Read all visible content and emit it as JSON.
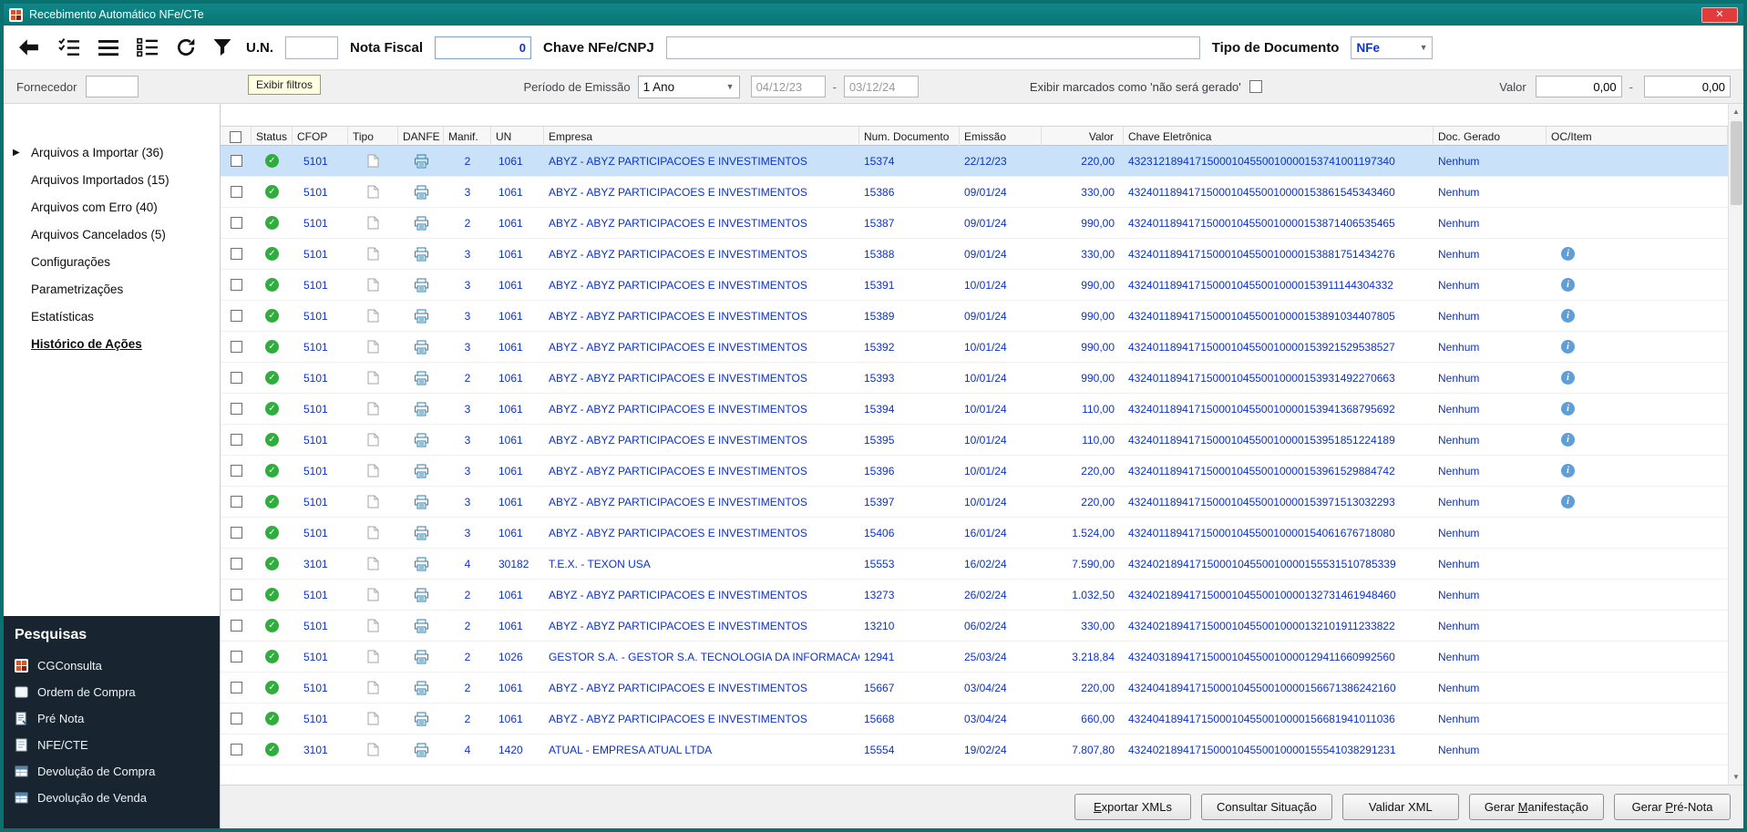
{
  "colors": {
    "data-blue": "#0d32c6",
    "status-green": "#2fae3d",
    "selection": "#c9e2f9",
    "dark-panel": "#18242f"
  },
  "window": {
    "title": "Recebimento Automático NFe/CTe",
    "close_glyph": "✕"
  },
  "toolbar": {
    "icon_buttons": [
      "back-icon",
      "checklist-icon",
      "menu-lines-icon",
      "list-options-icon",
      "refresh-icon",
      "filter-funnel-icon"
    ],
    "un_label": "U.N.",
    "un_value": "",
    "nota_fiscal_label": "Nota Fiscal",
    "nota_fiscal_value": "0",
    "chave_label": "Chave NFe/CNPJ",
    "chave_value": "",
    "tipo_documento_label": "Tipo de Documento",
    "tipo_documento_value": "NFe",
    "filter_tooltip": "Exibir filtros"
  },
  "filters": {
    "fornecedor_label": "Fornecedor",
    "fornecedor_value": "",
    "periodo_label": "Período de Emissão",
    "periodo_value": "1 Ano",
    "date_from": "04/12/23",
    "range_separator": "-",
    "date_to": "03/12/24",
    "nao_sera_gerado_label": "Exibir marcados como 'não será gerado'",
    "valor_label": "Valor",
    "valor_from": "0,00",
    "valor_to": "0,00"
  },
  "sidebar": {
    "items": [
      {
        "name": "sidebar-item-arquivos-a-importar",
        "label": "Arquivos a Importar (36)",
        "current": true
      },
      {
        "name": "sidebar-item-arquivos-importados",
        "label": "Arquivos Importados (15)"
      },
      {
        "name": "sidebar-item-arquivos-com-erro",
        "label": "Arquivos com Erro (40)"
      },
      {
        "name": "sidebar-item-arquivos-cancelados",
        "label": "Arquivos Cancelados (5)"
      },
      {
        "name": "sidebar-item-configuracoes",
        "label": "Configurações"
      },
      {
        "name": "sidebar-item-parametrizacoes",
        "label": "Parametrizações"
      },
      {
        "name": "sidebar-item-estatisticas",
        "label": "Estatísticas"
      },
      {
        "name": "sidebar-item-historico-de-acoes",
        "label": "Histórico de Ações",
        "active": true
      }
    ],
    "pesquisas_title": "Pesquisas",
    "pesquisas": [
      {
        "name": "pesquisas-item-cgconsulta",
        "label": "CGConsulta",
        "icon": "cg-grid-icon"
      },
      {
        "name": "pesquisas-item-ordem-de-compra",
        "label": "Ordem de Compra",
        "icon": "order-icon"
      },
      {
        "name": "pesquisas-item-pre-nota",
        "label": "Pré Nota",
        "icon": "prenota-icon"
      },
      {
        "name": "pesquisas-item-nfe-cte",
        "label": "NFE/CTE",
        "icon": "nfe-page-icon"
      },
      {
        "name": "pesquisas-item-devolucao-de-compra",
        "label": "Devolução de Compra",
        "icon": "devolucao-compra-icon"
      },
      {
        "name": "pesquisas-item-devolucao-de-venda",
        "label": "Devolução de Venda",
        "icon": "devolucao-venda-icon"
      }
    ]
  },
  "table": {
    "headers": [
      "Status",
      "CFOP",
      "Tipo",
      "DANFE",
      "Manif.",
      "UN",
      "Empresa",
      "Num. Documento",
      "Emissão",
      "Valor",
      "Chave Eletrônica",
      "Doc. Gerado",
      "OC/Item"
    ],
    "rows": [
      {
        "cfop": "5101",
        "manif": "2",
        "un": "1061",
        "empresa": "ABYZ - ABYZ PARTICIPACOES E INVESTIMENTOS",
        "num": "15374",
        "emissao": "22/12/23",
        "valor": "220,00",
        "chave": "43231218941715000104550010000153741001197340",
        "doc": "Nenhum",
        "info": false,
        "selected": true
      },
      {
        "cfop": "5101",
        "manif": "3",
        "un": "1061",
        "empresa": "ABYZ - ABYZ PARTICIPACOES E INVESTIMENTOS",
        "num": "15386",
        "emissao": "09/01/24",
        "valor": "330,00",
        "chave": "43240118941715000104550010000153861545343460",
        "doc": "Nenhum",
        "info": false
      },
      {
        "cfop": "5101",
        "manif": "2",
        "un": "1061",
        "empresa": "ABYZ - ABYZ PARTICIPACOES E INVESTIMENTOS",
        "num": "15387",
        "emissao": "09/01/24",
        "valor": "990,00",
        "chave": "43240118941715000104550010000153871406535465",
        "doc": "Nenhum",
        "info": false
      },
      {
        "cfop": "5101",
        "manif": "3",
        "un": "1061",
        "empresa": "ABYZ - ABYZ PARTICIPACOES E INVESTIMENTOS",
        "num": "15388",
        "emissao": "09/01/24",
        "valor": "330,00",
        "chave": "43240118941715000104550010000153881751434276",
        "doc": "Nenhum",
        "info": true
      },
      {
        "cfop": "5101",
        "manif": "3",
        "un": "1061",
        "empresa": "ABYZ - ABYZ PARTICIPACOES E INVESTIMENTOS",
        "num": "15391",
        "emissao": "10/01/24",
        "valor": "990,00",
        "chave": "43240118941715000104550010000153911144304332",
        "doc": "Nenhum",
        "info": true
      },
      {
        "cfop": "5101",
        "manif": "3",
        "un": "1061",
        "empresa": "ABYZ - ABYZ PARTICIPACOES E INVESTIMENTOS",
        "num": "15389",
        "emissao": "09/01/24",
        "valor": "990,00",
        "chave": "43240118941715000104550010000153891034407805",
        "doc": "Nenhum",
        "info": true
      },
      {
        "cfop": "5101",
        "manif": "3",
        "un": "1061",
        "empresa": "ABYZ - ABYZ PARTICIPACOES E INVESTIMENTOS",
        "num": "15392",
        "emissao": "10/01/24",
        "valor": "990,00",
        "chave": "43240118941715000104550010000153921529538527",
        "doc": "Nenhum",
        "info": true
      },
      {
        "cfop": "5101",
        "manif": "2",
        "un": "1061",
        "empresa": "ABYZ - ABYZ PARTICIPACOES E INVESTIMENTOS",
        "num": "15393",
        "emissao": "10/01/24",
        "valor": "990,00",
        "chave": "43240118941715000104550010000153931492270663",
        "doc": "Nenhum",
        "info": true
      },
      {
        "cfop": "5101",
        "manif": "3",
        "un": "1061",
        "empresa": "ABYZ - ABYZ PARTICIPACOES E INVESTIMENTOS",
        "num": "15394",
        "emissao": "10/01/24",
        "valor": "110,00",
        "chave": "43240118941715000104550010000153941368795692",
        "doc": "Nenhum",
        "info": true
      },
      {
        "cfop": "5101",
        "manif": "3",
        "un": "1061",
        "empresa": "ABYZ - ABYZ PARTICIPACOES E INVESTIMENTOS",
        "num": "15395",
        "emissao": "10/01/24",
        "valor": "110,00",
        "chave": "43240118941715000104550010000153951851224189",
        "doc": "Nenhum",
        "info": true
      },
      {
        "cfop": "5101",
        "manif": "3",
        "un": "1061",
        "empresa": "ABYZ - ABYZ PARTICIPACOES E INVESTIMENTOS",
        "num": "15396",
        "emissao": "10/01/24",
        "valor": "220,00",
        "chave": "43240118941715000104550010000153961529884742",
        "doc": "Nenhum",
        "info": true
      },
      {
        "cfop": "5101",
        "manif": "3",
        "un": "1061",
        "empresa": "ABYZ - ABYZ PARTICIPACOES E INVESTIMENTOS",
        "num": "15397",
        "emissao": "10/01/24",
        "valor": "220,00",
        "chave": "43240118941715000104550010000153971513032293",
        "doc": "Nenhum",
        "info": true
      },
      {
        "cfop": "5101",
        "manif": "3",
        "un": "1061",
        "empresa": "ABYZ - ABYZ PARTICIPACOES E INVESTIMENTOS",
        "num": "15406",
        "emissao": "16/01/24",
        "valor": "1.524,00",
        "chave": "43240118941715000104550010000154061676718080",
        "doc": "Nenhum",
        "info": false
      },
      {
        "cfop": "3101",
        "manif": "4",
        "un": "30182",
        "empresa": "T.E.X. - TEXON USA",
        "num": "15553",
        "emissao": "16/02/24",
        "valor": "7.590,00",
        "chave": "43240218941715000104550010000155531510785339",
        "doc": "Nenhum",
        "info": false
      },
      {
        "cfop": "5101",
        "manif": "2",
        "un": "1061",
        "empresa": "ABYZ - ABYZ PARTICIPACOES E INVESTIMENTOS",
        "num": "13273",
        "emissao": "26/02/24",
        "valor": "1.032,50",
        "chave": "43240218941715000104550010000132731461948460",
        "doc": "Nenhum",
        "info": false
      },
      {
        "cfop": "5101",
        "manif": "2",
        "un": "1061",
        "empresa": "ABYZ - ABYZ PARTICIPACOES E INVESTIMENTOS",
        "num": "13210",
        "emissao": "06/02/24",
        "valor": "330,00",
        "chave": "43240218941715000104550010000132101911233822",
        "doc": "Nenhum",
        "info": false
      },
      {
        "cfop": "5101",
        "manif": "2",
        "un": "1026",
        "empresa": "GESTOR S.A. - GESTOR S.A. TECNOLOGIA DA INFORMACAO",
        "num": "12941",
        "emissao": "25/03/24",
        "valor": "3.218,84",
        "chave": "43240318941715000104550010000129411660992560",
        "doc": "Nenhum",
        "info": false
      },
      {
        "cfop": "5101",
        "manif": "2",
        "un": "1061",
        "empresa": "ABYZ - ABYZ PARTICIPACOES E INVESTIMENTOS",
        "num": "15667",
        "emissao": "03/04/24",
        "valor": "220,00",
        "chave": "43240418941715000104550010000156671386242160",
        "doc": "Nenhum",
        "info": false
      },
      {
        "cfop": "5101",
        "manif": "2",
        "un": "1061",
        "empresa": "ABYZ - ABYZ PARTICIPACOES E INVESTIMENTOS",
        "num": "15668",
        "emissao": "03/04/24",
        "valor": "660,00",
        "chave": "43240418941715000104550010000156681941011036",
        "doc": "Nenhum",
        "info": false
      },
      {
        "cfop": "3101",
        "manif": "4",
        "un": "1420",
        "empresa": "ATUAL - EMPRESA ATUAL LTDA",
        "num": "15554",
        "emissao": "19/02/24",
        "valor": "7.807,80",
        "chave": "43240218941715000104550010000155541038291231",
        "doc": "Nenhum",
        "info": false
      }
    ]
  },
  "footer": {
    "buttons": [
      {
        "name": "exportar-xmls-button",
        "label": "Exportar XMLs",
        "key": "E"
      },
      {
        "name": "consultar-situacao-button",
        "label": "Consultar Situação",
        "key": ""
      },
      {
        "name": "validar-xml-button",
        "label": "Validar XML",
        "key": ""
      },
      {
        "name": "gerar-manifestacao-button",
        "label": "Gerar Manifestação",
        "key": "M"
      },
      {
        "name": "gerar-pre-nota-button",
        "label": "Gerar Pré-Nota",
        "key": "P"
      }
    ]
  }
}
